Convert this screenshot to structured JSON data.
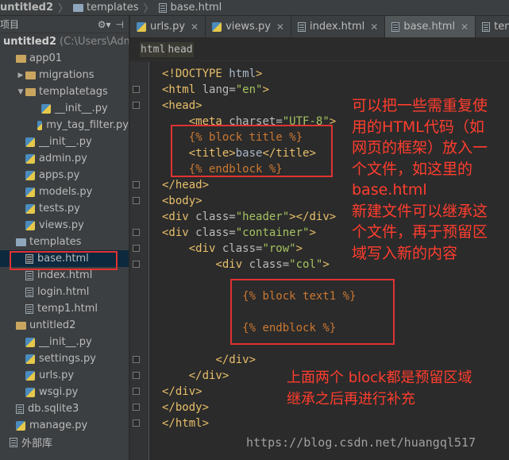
{
  "breadcrumb": [
    {
      "label": "untitled2",
      "icon": "folder-icon"
    },
    {
      "label": "templates",
      "icon": "folder-icon"
    },
    {
      "label": "base.html",
      "icon": "html-file-icon"
    }
  ],
  "sidebar": {
    "title": "项目",
    "tree": [
      {
        "label": "untitled2",
        "path": "(C:\\Users\\Admir",
        "level": 0,
        "icon": "folder-icon",
        "arrow": "▼",
        "bold": true
      },
      {
        "label": "app01",
        "level": 1,
        "icon": "folder-icon",
        "arrow": "▼"
      },
      {
        "label": "migrations",
        "level": 2,
        "icon": "folder-icon",
        "arrow": "▶"
      },
      {
        "label": "templatetags",
        "level": 2,
        "icon": "folder-icon",
        "arrow": "▼"
      },
      {
        "label": "__init__.py",
        "level": 3,
        "icon": "python-file-icon"
      },
      {
        "label": "my_tag_filter.py",
        "level": 3,
        "icon": "python-file-icon"
      },
      {
        "label": "__init__.py",
        "level": 2,
        "icon": "python-file-icon"
      },
      {
        "label": "admin.py",
        "level": 2,
        "icon": "python-file-icon"
      },
      {
        "label": "apps.py",
        "level": 2,
        "icon": "python-file-icon"
      },
      {
        "label": "models.py",
        "level": 2,
        "icon": "python-file-icon"
      },
      {
        "label": "tests.py",
        "level": 2,
        "icon": "python-file-icon"
      },
      {
        "label": "views.py",
        "level": 2,
        "icon": "python-file-icon"
      },
      {
        "label": "templates",
        "level": 1,
        "icon": "folder-icon"
      },
      {
        "label": "base.html",
        "level": 2,
        "icon": "html-file-icon",
        "selected": true
      },
      {
        "label": "index.html",
        "level": 2,
        "icon": "html-file-icon"
      },
      {
        "label": "login.html",
        "level": 2,
        "icon": "html-file-icon"
      },
      {
        "label": "temp1.html",
        "level": 2,
        "icon": "html-file-icon"
      },
      {
        "label": "untitled2",
        "level": 1,
        "icon": "folder-icon",
        "arrow": "▼"
      },
      {
        "label": "__init__.py",
        "level": 2,
        "icon": "python-file-icon"
      },
      {
        "label": "settings.py",
        "level": 2,
        "icon": "python-file-icon"
      },
      {
        "label": "urls.py",
        "level": 2,
        "icon": "python-file-icon"
      },
      {
        "label": "wsgi.py",
        "level": 2,
        "icon": "python-file-icon"
      },
      {
        "label": "db.sqlite3",
        "level": 1,
        "icon": "database-file-icon"
      },
      {
        "label": "manage.py",
        "level": 1,
        "icon": "python-file-icon"
      },
      {
        "label": "外部库",
        "level": 0,
        "icon": "library-icon"
      }
    ]
  },
  "tabs": [
    {
      "label": "urls.py",
      "icon": "python-file-icon"
    },
    {
      "label": "views.py",
      "icon": "python-file-icon"
    },
    {
      "label": "index.html",
      "icon": "html-file-icon"
    },
    {
      "label": "base.html",
      "icon": "html-file-icon",
      "active": true
    },
    {
      "label": "temp",
      "icon": "html-file-icon"
    }
  ],
  "tag_breadcrumb": [
    "html",
    "head"
  ],
  "code": [
    {
      "text": "<!DOCTYPE html>"
    },
    {
      "text": "<html lang=\"en\">"
    },
    {
      "text": "<head>"
    },
    {
      "text": "    <meta charset=\"UTF-8\">"
    },
    {
      "text": "    {% block title %}"
    },
    {
      "text": "    <title>base</title>"
    },
    {
      "text": "    {% endblock %}"
    },
    {
      "text": "</head>"
    },
    {
      "text": "<body>"
    },
    {
      "text": "<div class=\"header\"></div>"
    },
    {
      "text": "<div class=\"container\">"
    },
    {
      "text": "    <div class=\"row\">"
    },
    {
      "text": "        <div class=\"col\">"
    },
    {
      "text": ""
    },
    {
      "text": "            {% block text1 %}"
    },
    {
      "text": ""
    },
    {
      "text": "            {% endblock %}"
    },
    {
      "text": ""
    },
    {
      "text": "        </div>"
    },
    {
      "text": "    </div>"
    },
    {
      "text": "</div>"
    },
    {
      "text": "</body>"
    },
    {
      "text": "</html>"
    }
  ],
  "annotations": {
    "note1": "可以把一些需重复使\n用的HTML代码（如\n网页的框架）放入一\n个文件，如这里的\nbase.html\n新建文件可以继承这\n个文件，再于预留区\n域写入新的内容",
    "note2": "上面两个 block都是预留区域\n继承之后再进行补充"
  },
  "watermark": "https://blog.csdn.net/huangql517",
  "colors": {
    "annotation": "#ff3d2e",
    "highlight_box": "#e03232",
    "tag": "#e8bf6a",
    "attr_name": "#bababa",
    "attr_value": "#a5c261",
    "template_tag": "#cc7832",
    "text": "#a9b7c6"
  }
}
